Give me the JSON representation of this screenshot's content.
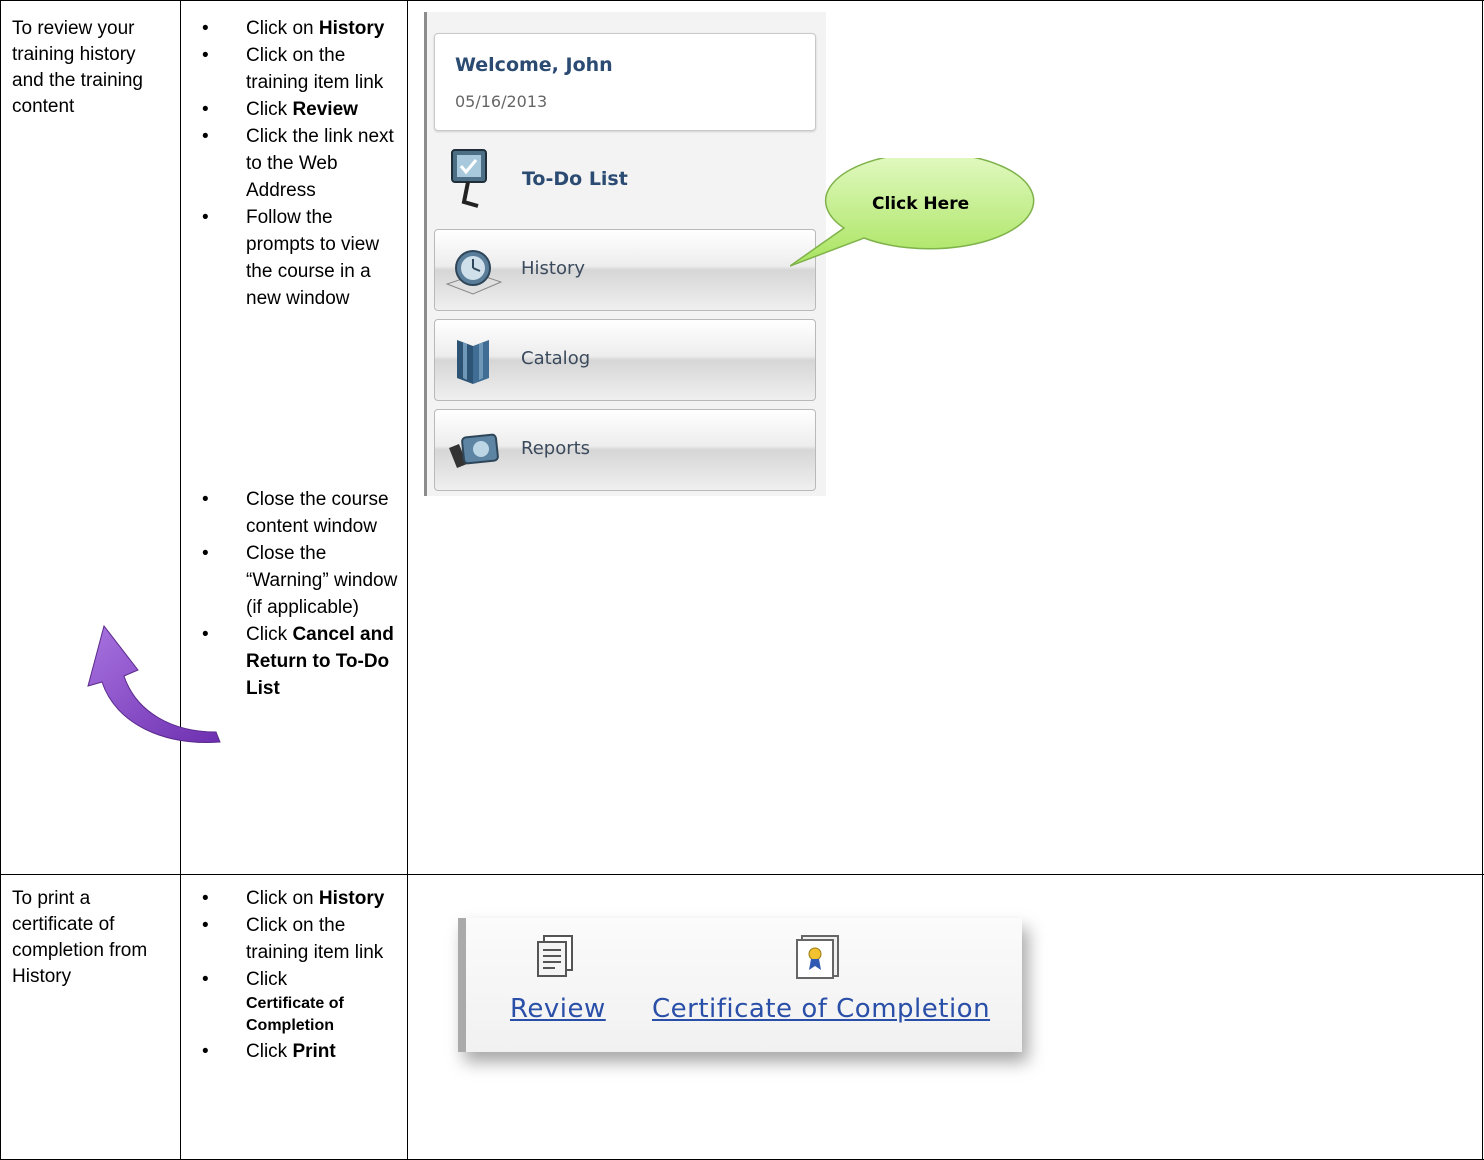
{
  "rows": [
    {
      "task": "To review your training history and the training content",
      "steps": [
        {
          "pre": "Click on ",
          "bold": "History",
          "post": ""
        },
        {
          "pre": "Click on the training item link",
          "bold": "",
          "post": ""
        },
        {
          "pre": "Click ",
          "bold": "Review",
          "post": ""
        },
        {
          "pre": "Click the link next to the Web Address",
          "bold": "",
          "post": ""
        },
        {
          "pre": "Follow the prompts to view the course in a new window",
          "bold": "",
          "post": ""
        }
      ],
      "steps2": [
        {
          "pre": "Close the course content window",
          "bold": "",
          "post": ""
        },
        {
          "pre": "Close the “Warning” window (if applicable)",
          "bold": "",
          "post": ""
        },
        {
          "pre": "Click ",
          "bold": "Cancel and Return to To-Do List",
          "post": ""
        }
      ]
    },
    {
      "task": "To print a certificate of completion from History",
      "steps": [
        {
          "pre": "Click on ",
          "bold": "History",
          "post": ""
        },
        {
          "pre": "Click on the training item link",
          "bold": "",
          "post": ""
        },
        {
          "pre": "Click ",
          "bold": "Certificate of Completion",
          "post": ""
        },
        {
          "pre": "Click ",
          "bold": "Print",
          "post": ""
        }
      ]
    }
  ],
  "sidebar": {
    "welcome": "Welcome, John",
    "date": "05/16/2013",
    "todo": "To-Do List",
    "items": [
      {
        "label": "History",
        "icon": "clock-icon"
      },
      {
        "label": "Catalog",
        "icon": "books-icon"
      },
      {
        "label": "Reports",
        "icon": "reports-icon"
      }
    ]
  },
  "callout": "Click Here",
  "cert": {
    "review": "Review",
    "certificate": "Certificate of Completion"
  },
  "colors": {
    "callout_fill": "#b9ef7a",
    "arrow_fill": "#8b4fc9",
    "link": "#2a4fa8",
    "nav_text": "#2c4b73"
  }
}
